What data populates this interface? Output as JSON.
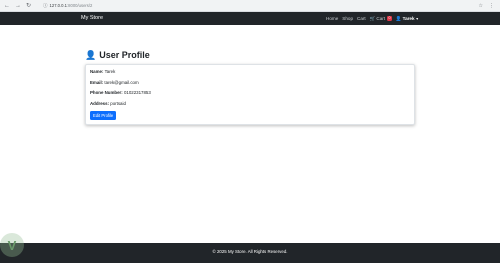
{
  "browser": {
    "back_icon": "arrow-left-icon",
    "forward_icon": "arrow-right-icon",
    "reload_icon": "reload-icon",
    "url_host": "127.0.0.1",
    "url_path": ":8000/users/2"
  },
  "navbar": {
    "brand": "My Store",
    "links": [
      "Home",
      "Shop",
      "Cart"
    ],
    "cart_label": "Cart",
    "cart_count": "0",
    "user_name": "Tarek"
  },
  "profile": {
    "title": "User Profile",
    "fields": [
      {
        "label": "Name:",
        "value": "Tarek"
      },
      {
        "label": "Email:",
        "value": "tarek@gmail.com"
      },
      {
        "label": "Phone Number:",
        "value": "01022317853"
      },
      {
        "label": "Address:",
        "value": "portsaid"
      }
    ],
    "edit_button": "Edit Profile"
  },
  "footer": {
    "text": "© 2025 My Store. All Rights Reserved."
  }
}
